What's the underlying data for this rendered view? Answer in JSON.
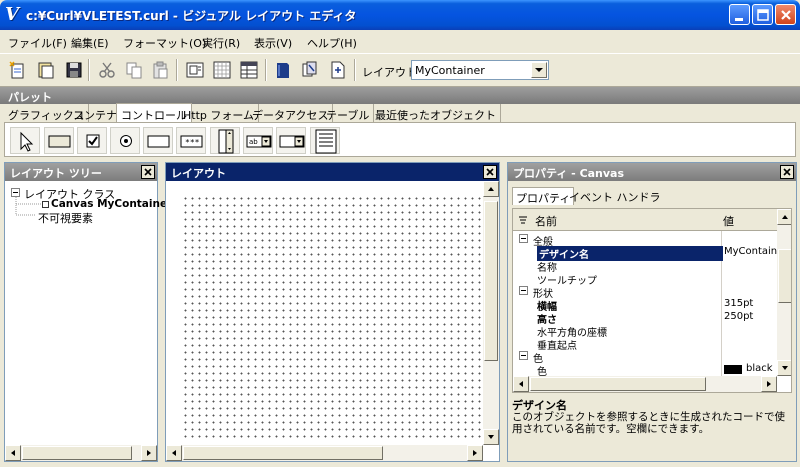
{
  "window": {
    "title": "c:¥Curl¥VLETEST.curl - ビジュアル レイアウト エディタ",
    "accent": "#0554e0"
  },
  "menu": [
    "ファイル(F)",
    "編集(E)",
    "フォーマット(O)",
    "実行(R)",
    "表示(V)",
    "ヘルプ(H)"
  ],
  "toolbar": {
    "layout_label": "レイアウト:",
    "layout_value": "MyContainer"
  },
  "palette": {
    "title": "パレット",
    "tabs": [
      "グラフィックス",
      "コンテナ",
      "コントロール",
      "Http フォーム",
      "データアクセス",
      "テーブル",
      "最近使ったオブジェクト"
    ],
    "active_tab": "コントロール"
  },
  "tree": {
    "title": "レイアウト ツリー",
    "root": "レイアウト クラス",
    "child": "Canvas MyContainer",
    "invisible": "不可視要素"
  },
  "layout": {
    "title": "レイアウト"
  },
  "props": {
    "title": "プロパティ - Canvas",
    "tabs": [
      "プロパティ",
      "イベント ハンドラ"
    ],
    "col_name": "名前",
    "col_value": "値",
    "rows": [
      {
        "label": "全般"
      },
      {
        "label": "デザイン名",
        "value": "MyContainer"
      },
      {
        "label": "名称",
        "value": ""
      },
      {
        "label": "ツールチップ",
        "value": ""
      },
      {
        "label": "形状"
      },
      {
        "label": "横幅",
        "value": "315pt"
      },
      {
        "label": "高さ",
        "value": "250pt"
      },
      {
        "label": "水平方角の座標",
        "value": ""
      },
      {
        "label": "垂直起点",
        "value": ""
      },
      {
        "label": "色"
      },
      {
        "label": "色",
        "value": "black"
      }
    ],
    "desc_title": "デザイン名",
    "desc_text": "このオブジェクトを参照するときに生成されたコードで使用されている名前です。空欄にできます。"
  }
}
